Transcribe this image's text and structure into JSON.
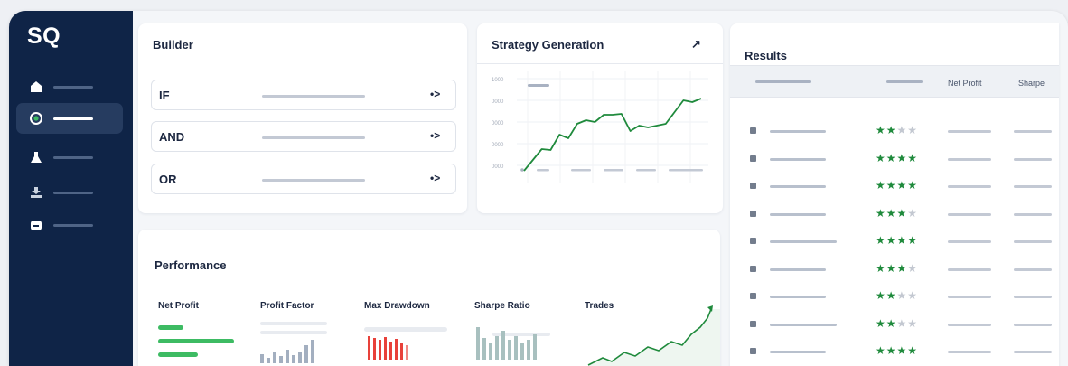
{
  "app": {
    "logo": "SQ"
  },
  "sidebar": {
    "items": [
      {
        "icon": "home-icon",
        "active": false
      },
      {
        "icon": "target-icon",
        "active": true
      },
      {
        "icon": "flask-icon",
        "active": false
      },
      {
        "icon": "portfolio-icon",
        "active": false
      },
      {
        "icon": "database-icon",
        "active": false
      }
    ]
  },
  "builder": {
    "title": "Builder",
    "rows": [
      {
        "label": "IF",
        "arrow": "•>"
      },
      {
        "label": "AND",
        "arrow": "•>"
      },
      {
        "label": "OR",
        "arrow": "•>"
      }
    ]
  },
  "strategy": {
    "title": "Strategy Generation",
    "expand_glyph": "↗",
    "y_ticks": [
      "1000",
      "0000",
      "0000",
      "0000",
      "0000"
    ]
  },
  "results": {
    "title": "Results",
    "columns": [
      "Net Profit",
      "Sharpe"
    ],
    "ratings": [
      2,
      4,
      4,
      3,
      4,
      3,
      2,
      2,
      4
    ]
  },
  "performance": {
    "title": "Performance",
    "metrics": [
      "Net Profit",
      "Profit Factor",
      "Max Drawdown",
      "Sharpe Ratio",
      "Trades"
    ]
  },
  "chart_data": {
    "type": "line",
    "title": "Strategy Generation",
    "series": [
      {
        "values": [
          10,
          22,
          34,
          33,
          50,
          46,
          62,
          66,
          64,
          72,
          72,
          73,
          54,
          60,
          58,
          60,
          62,
          75,
          88,
          86,
          90
        ]
      }
    ],
    "color": "#1f8a3c",
    "grid": true
  },
  "colors": {
    "sidebar_bg": "#0f2447",
    "accent_green": "#1f8a3c",
    "bar_green": "#3dbb63",
    "drawdown_red": "#e8413a",
    "placeholder_gray": "#c3c9d4"
  }
}
